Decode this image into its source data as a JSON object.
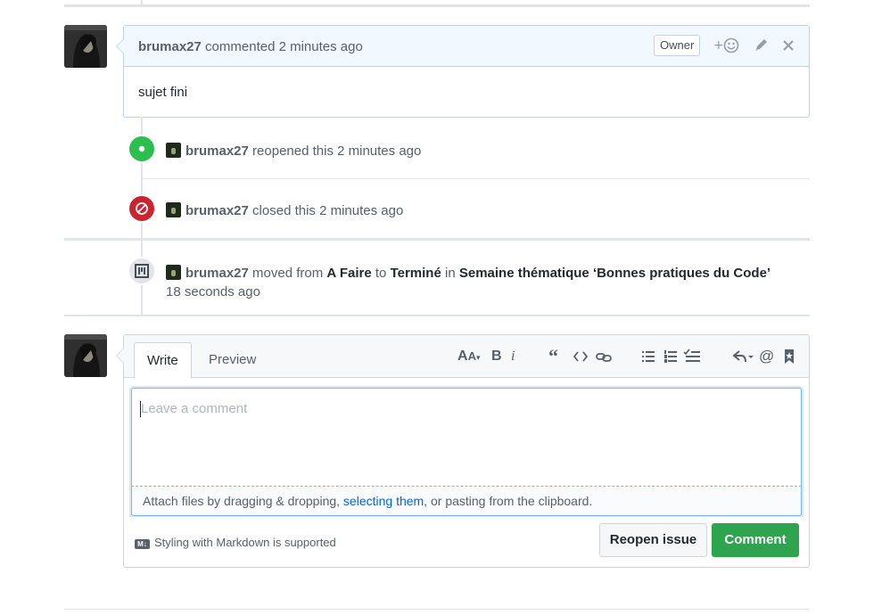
{
  "comment": {
    "author": "brumax27",
    "action_text": "commented 2 minutes ago",
    "owner_label": "Owner",
    "body": "sujet fini",
    "icons": [
      "add-reaction-icon",
      "pencil-icon",
      "close-icon"
    ]
  },
  "events": {
    "reopened": {
      "author": "brumax27",
      "text": "reopened this 2 minutes ago",
      "color": "#2cbe4e"
    },
    "closed": {
      "author": "brumax27",
      "text": "closed this 2 minutes ago",
      "color": "#cb2431"
    },
    "moved": {
      "author": "brumax27",
      "moved_from": "moved from",
      "from": "A Faire",
      "to_word": "to",
      "to": "Terminé",
      "in_word": "in",
      "project": "Semaine thématique ‘Bonnes pratiques du Code’",
      "time": "18 seconds ago"
    }
  },
  "editor": {
    "tabs": [
      "Write",
      "Preview"
    ],
    "active_tab": "Write",
    "placeholder": "Leave a comment",
    "attach_prefix": "Attach files by dragging & dropping, ",
    "attach_link": "selecting them",
    "attach_suffix": ", or pasting from the clipboard.",
    "markdown_note": "Styling with Markdown is supported",
    "markdown_badge": "M↓",
    "reopen_label": "Reopen issue",
    "comment_label": "Comment",
    "toolbar_icons": [
      "header-icon",
      "bold-icon",
      "italic-icon",
      "quote-icon",
      "code-icon",
      "link-icon",
      "unordered-list-icon",
      "ordered-list-icon",
      "task-list-icon",
      "reply-icon",
      "mention-icon",
      "bookmark-icon"
    ]
  },
  "colors": {
    "accent": "#0366d6",
    "comment_button": "#2ea44f",
    "comment_header": "#f1f8ff"
  }
}
